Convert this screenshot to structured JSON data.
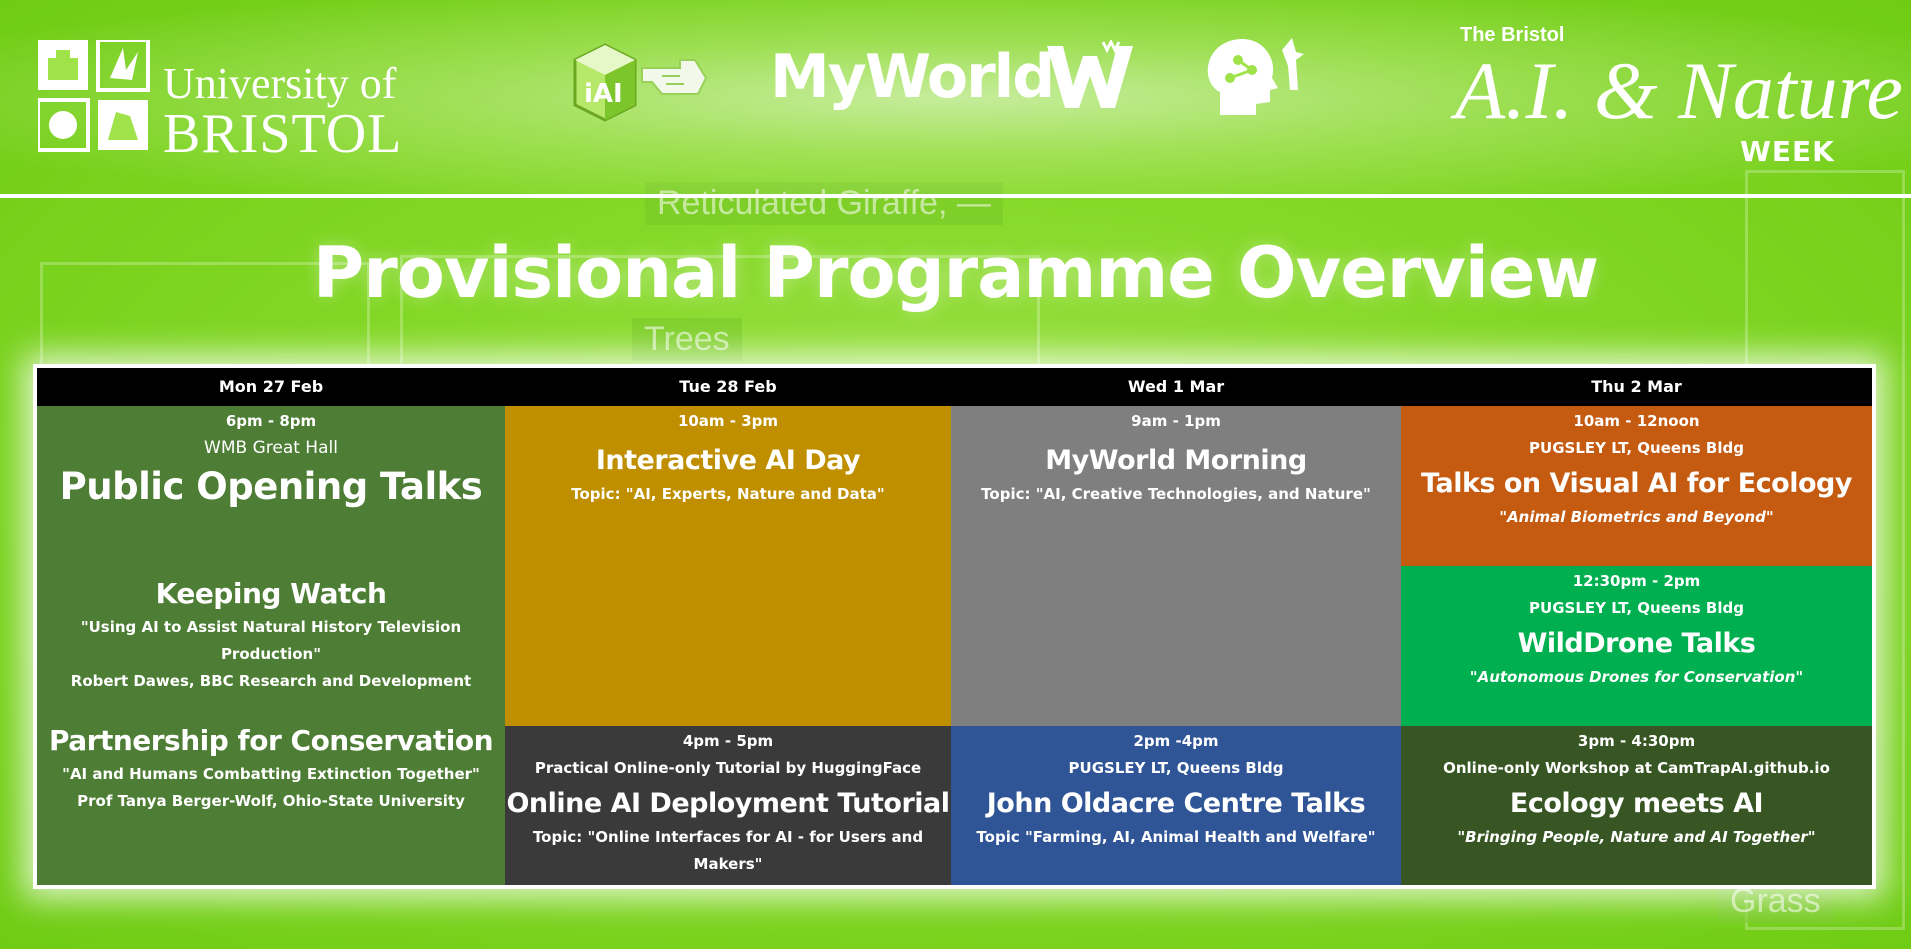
{
  "header": {
    "uob_logo": {
      "line1": "University of",
      "line2": "BRISTOL"
    },
    "myworld_logo": "MyWorld",
    "event_logo": {
      "small": "The Bristol",
      "big": "A.I. & Nature",
      "week": "WEEK"
    }
  },
  "background_labels": [
    "Reticulated Giraffe, —",
    "Trees",
    "Grass"
  ],
  "title": "Provisional Programme Overview",
  "days": [
    "Mon 27 Feb",
    "Tue 28 Feb",
    "Wed 1 Mar",
    "Thu 2 Mar"
  ],
  "sessions": {
    "mon": {
      "time": "6pm - 8pm",
      "location": "WMB Great Hall",
      "title": "Public Opening Talks",
      "talk1": {
        "title": "Keeping Watch",
        "quote": "\"Using AI to Assist Natural History Television Production\"",
        "speaker": "Robert Dawes, BBC Research and Development"
      },
      "talk2": {
        "title": "Partnership for Conservation",
        "quote": "\"AI and Humans Combatting Extinction Together\"",
        "speaker": "Prof Tanya Berger-Wolf, Ohio-State University"
      }
    },
    "tue_am": {
      "time": "10am - 3pm",
      "title": "Interactive AI Day",
      "topic": "Topic: \"AI, Experts, Nature and Data\""
    },
    "wed_am": {
      "time": "9am - 1pm",
      "title": "MyWorld Morning",
      "topic": "Topic: \"AI, Creative Technologies, and Nature\""
    },
    "thu_am": {
      "time": "10am - 12noon",
      "location": "PUGSLEY LT, Queens Bldg",
      "title": "Talks on Visual AI for Ecology",
      "subtitle": "\"Animal Biometrics and Beyond\""
    },
    "thu_mid": {
      "time": "12:30pm - 2pm",
      "location": "PUGSLEY LT, Queens Bldg",
      "title": "WildDrone Talks",
      "subtitle": "\"Autonomous Drones for Conservation\""
    },
    "tue_pm": {
      "time": "4pm - 5pm",
      "location": "Practical Online-only Tutorial by HuggingFace",
      "title": "Online AI Deployment Tutorial",
      "topic": "Topic: \"Online Interfaces for AI - for Users and Makers\""
    },
    "wed_pm": {
      "time": "2pm -4pm",
      "location": "PUGSLEY LT, Queens Bldg",
      "title": "John Oldacre Centre Talks",
      "topic": "Topic \"Farming, AI, Animal Health and Welfare\""
    },
    "thu_pm": {
      "time": "3pm - 4:30pm",
      "location": "Online-only Workshop at CamTrapAI.github.io",
      "title": "Ecology meets AI",
      "subtitle": "\"Bringing People, Nature and AI Together\""
    }
  },
  "colors": {
    "mon": "#4e7d35",
    "tue_am": "#bf8f00",
    "wed_am": "#7f7f7f",
    "thu_am": "#c55a11",
    "thu_mid": "#00b050",
    "tue_pm": "#3a3a3a",
    "wed_pm": "#2f5597",
    "thu_pm": "#375623"
  },
  "icons": [
    "uob-crest-icon",
    "iai-cube-icon",
    "pointing-hand-icon",
    "wildlife-w-icon",
    "ai-head-icon"
  ]
}
